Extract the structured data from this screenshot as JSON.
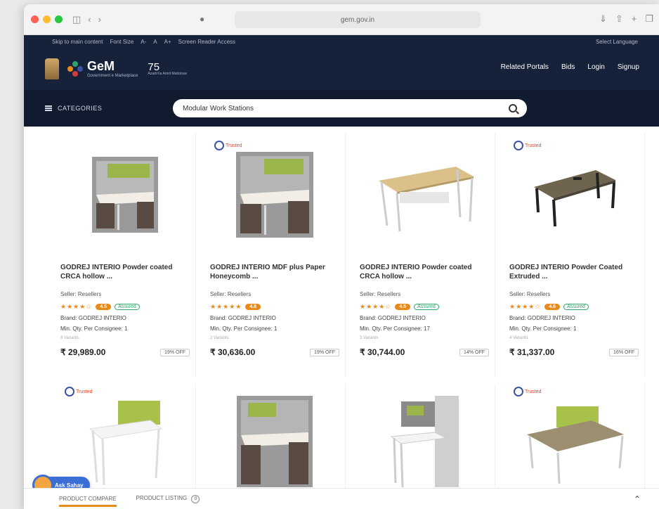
{
  "browser": {
    "url": "gem.gov.in",
    "url_right": "◀ ▷",
    "colors": {
      "close": "#ff5f57",
      "min": "#febc2e",
      "max": "#28c840"
    }
  },
  "topstrip": {
    "links": [
      "Skip to main content",
      "Font Size",
      "A-",
      "A",
      "A+",
      "Screen Reader Access"
    ],
    "language": "Select Language"
  },
  "header": {
    "logo_text": "GeM",
    "logo_sub": "Government e Marketplace",
    "azadi_text": "75",
    "azadi_sub": "Azadi Ka Amrit Mahotsav",
    "nav": [
      "Related Portals",
      "Bids",
      "Login",
      "Signup"
    ]
  },
  "searchrow": {
    "categories_label": "CATEGORIES",
    "search_value": "Modular Work Stations"
  },
  "products": [
    {
      "title": "GODREJ INTERIO Powder coated CRCA hollow ...",
      "seller": "Seller: Resellers",
      "stars": "★★★★☆",
      "rating_pill": "4.5",
      "assured": "Assured",
      "brand": "Brand: GODREJ INTERIO",
      "min_qty": "Min. Qty. Per Consignee: 1",
      "tiny": "8 Variants",
      "price": "₹ 29,989.00",
      "discount": "19% OFF",
      "trusted": false
    },
    {
      "title": "GODREJ INTERIO MDF plus Paper Honeycomb ...",
      "seller": "Seller: Resellers",
      "stars": "★★★★★",
      "rating_pill": "4.8",
      "assured": "",
      "brand": "Brand: GODREJ INTERIO",
      "min_qty": "Min. Qty. Per Consignee: 1",
      "tiny": "2 Variants",
      "price": "₹ 30,636.00",
      "discount": "19% OFF",
      "trusted": true
    },
    {
      "title": "GODREJ INTERIO Powder coated CRCA hollow ...",
      "seller": "Seller: Resellers",
      "stars": "★★★★☆",
      "rating_pill": "4.5",
      "assured": "Assured",
      "brand": "Brand: GODREJ INTERIO",
      "min_qty": "Min. Qty. Per Consignee: 17",
      "tiny": "3 Variants",
      "price": "₹ 30,744.00",
      "discount": "14% OFF",
      "trusted": false
    },
    {
      "title": "GODREJ INTERIO Powder Coated Extruded ...",
      "seller": "Seller: Resellers",
      "stars": "★★★★☆",
      "rating_pill": "4.6",
      "assured": "Assured",
      "brand": "Brand: GODREJ INTERIO",
      "min_qty": "Min. Qty. Per Consignee: 1",
      "tiny": "4 Variants",
      "price": "₹ 31,337.00",
      "discount": "16% OFF",
      "trusted": true
    }
  ],
  "row2_trusted": [
    true,
    false,
    false,
    true
  ],
  "trusted_label": "Trusted",
  "bottombar": {
    "tab1": "PRODUCT COMPARE",
    "tab2": "PRODUCT LISTING",
    "tab2_count": "0"
  },
  "ask_button": "Ask Sahay"
}
